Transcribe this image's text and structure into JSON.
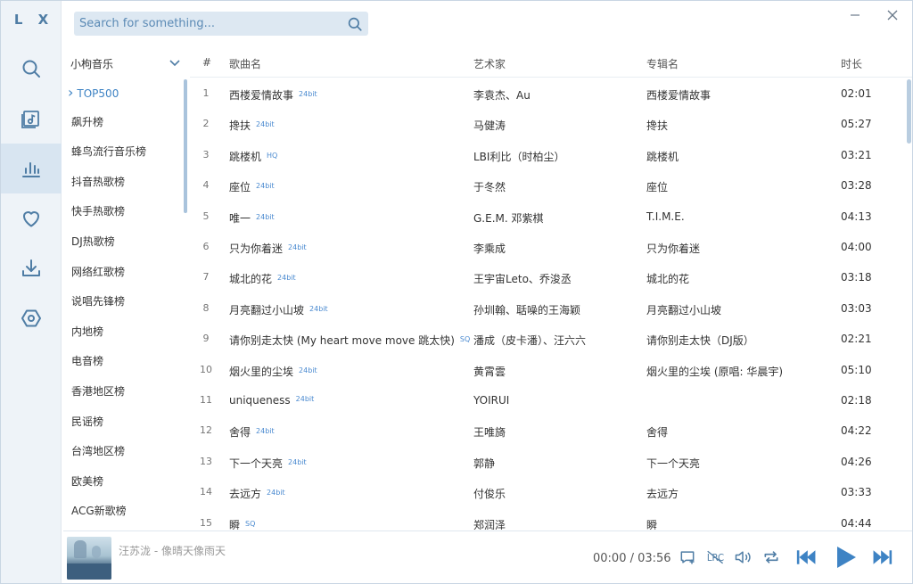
{
  "app": {
    "logo": "L X"
  },
  "rail": {
    "items": [
      {
        "name": "search-icon"
      },
      {
        "name": "song-list-icon"
      },
      {
        "name": "leaderboard-icon",
        "active": true
      },
      {
        "name": "heart-icon"
      },
      {
        "name": "download-icon"
      },
      {
        "name": "settings-icon"
      }
    ]
  },
  "search": {
    "placeholder": "Search for something..."
  },
  "sidebar": {
    "source": "小枸音乐",
    "boards": [
      "TOP500",
      "飙升榜",
      "蜂鸟流行音乐榜",
      "抖音热歌榜",
      "快手热歌榜",
      "DJ热歌榜",
      "网络红歌榜",
      "说唱先锋榜",
      "内地榜",
      "电音榜",
      "香港地区榜",
      "民谣榜",
      "台湾地区榜",
      "欧美榜",
      "ACG新歌榜"
    ],
    "active_index": 0
  },
  "table": {
    "headers": {
      "num": "#",
      "title": "歌曲名",
      "artist": "艺术家",
      "album": "专辑名",
      "duration": "时长"
    },
    "rows": [
      {
        "num": "1",
        "title": "西楼爱情故事",
        "tag": "24bit",
        "artist": "李袁杰、Au",
        "album": "西楼爱情故事",
        "duration": "02:01"
      },
      {
        "num": "2",
        "title": "搀扶",
        "tag": "24bit",
        "artist": "马健涛",
        "album": "搀扶",
        "duration": "05:27"
      },
      {
        "num": "3",
        "title": "跳楼机",
        "tag": "HQ",
        "artist": "LBI利比（时柏尘）",
        "album": "跳楼机",
        "duration": "03:21"
      },
      {
        "num": "4",
        "title": "座位",
        "tag": "24bit",
        "artist": "于冬然",
        "album": "座位",
        "duration": "03:28"
      },
      {
        "num": "5",
        "title": "唯一",
        "tag": "24bit",
        "artist": "G.E.M. 邓紫棋",
        "album": "T.I.M.E.",
        "duration": "04:13"
      },
      {
        "num": "6",
        "title": "只为你着迷",
        "tag": "24bit",
        "artist": "李乘成",
        "album": "只为你着迷",
        "duration": "04:00"
      },
      {
        "num": "7",
        "title": "城北的花",
        "tag": "24bit",
        "artist": "王宇宙Leto、乔浚丞",
        "album": "城北的花",
        "duration": "03:18"
      },
      {
        "num": "8",
        "title": "月亮翻过小山坡",
        "tag": "24bit",
        "artist": "孙圳翰、聒噪的王海颖",
        "album": "月亮翻过小山坡",
        "duration": "03:03"
      },
      {
        "num": "9",
        "title": "请你别走太快 (My heart move move 跳太快)",
        "tag": "SQ",
        "artist": "潘成（皮卡潘）、汪六六",
        "album": "请你别走太快（DJ版）",
        "duration": "02:21"
      },
      {
        "num": "10",
        "title": "烟火里的尘埃",
        "tag": "24bit",
        "artist": "黄霄雲",
        "album": "烟火里的尘埃 (原唱: 华晨宇)",
        "duration": "05:10"
      },
      {
        "num": "11",
        "title": "uniqueness",
        "tag": "24bit",
        "artist": "YOIRUI",
        "album": "",
        "duration": "02:18"
      },
      {
        "num": "12",
        "title": "舍得",
        "tag": "24bit",
        "artist": "王唯旖",
        "album": "舍得",
        "duration": "04:22"
      },
      {
        "num": "13",
        "title": "下一个天亮",
        "tag": "24bit",
        "artist": "郭静",
        "album": "下一个天亮",
        "duration": "04:26"
      },
      {
        "num": "14",
        "title": "去远方",
        "tag": "24bit",
        "artist": "付俊乐",
        "album": "去远方",
        "duration": "03:33"
      },
      {
        "num": "15",
        "title": "瞬",
        "tag": "SQ",
        "artist": "郑润泽",
        "album": "瞬",
        "duration": "04:44"
      }
    ]
  },
  "player": {
    "now_playing": "汪苏泷 - 像晴天像雨天",
    "time": "00:00 / 03:56",
    "controls": [
      "comment-icon",
      "lyrics-icon",
      "volume-icon",
      "repeat-icon",
      "previous-icon",
      "play-icon",
      "next-icon"
    ]
  },
  "colors": {
    "accent": "#3e83c4",
    "rail_bg": "#eef3f8",
    "search_bg": "#dde8f2"
  }
}
